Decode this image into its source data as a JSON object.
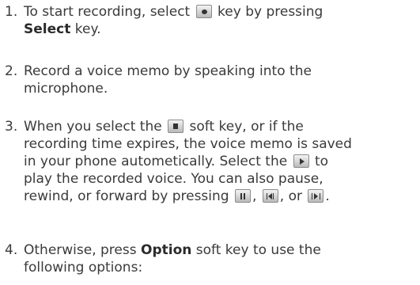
{
  "steps": [
    {
      "number": "1.",
      "line1_a": "To start recording, select",
      "line1_b": "key by pressing",
      "line2_bold": "Select",
      "line2_rest": " key.",
      "icon": "record-key-icon"
    },
    {
      "number": "2.",
      "line1": "Record a voice memo by speaking into the",
      "line2": "microphone."
    },
    {
      "number": "3.",
      "line1_a": "When you select the",
      "line1_b": "soft key, or if the",
      "line2": "recording time expires, the voice memo is saved",
      "line3": "in your phone autometically. Select the",
      "line4_a": "to",
      "line4": "play the recorded voice. You can also pause,",
      "line5_a": "rewind, or forward by pressing",
      "sep1": ",",
      "sep2": ", or",
      "end": ".",
      "icons": [
        "stop-key-icon",
        "play-key-icon",
        "pause-key-icon",
        "rewind-key-icon",
        "forward-key-icon"
      ]
    },
    {
      "number": "4.",
      "line1_a": "Otherwise, press",
      "line1_bold": "Option",
      "line1_b": " soft key to use the",
      "line2": "following options:"
    }
  ]
}
